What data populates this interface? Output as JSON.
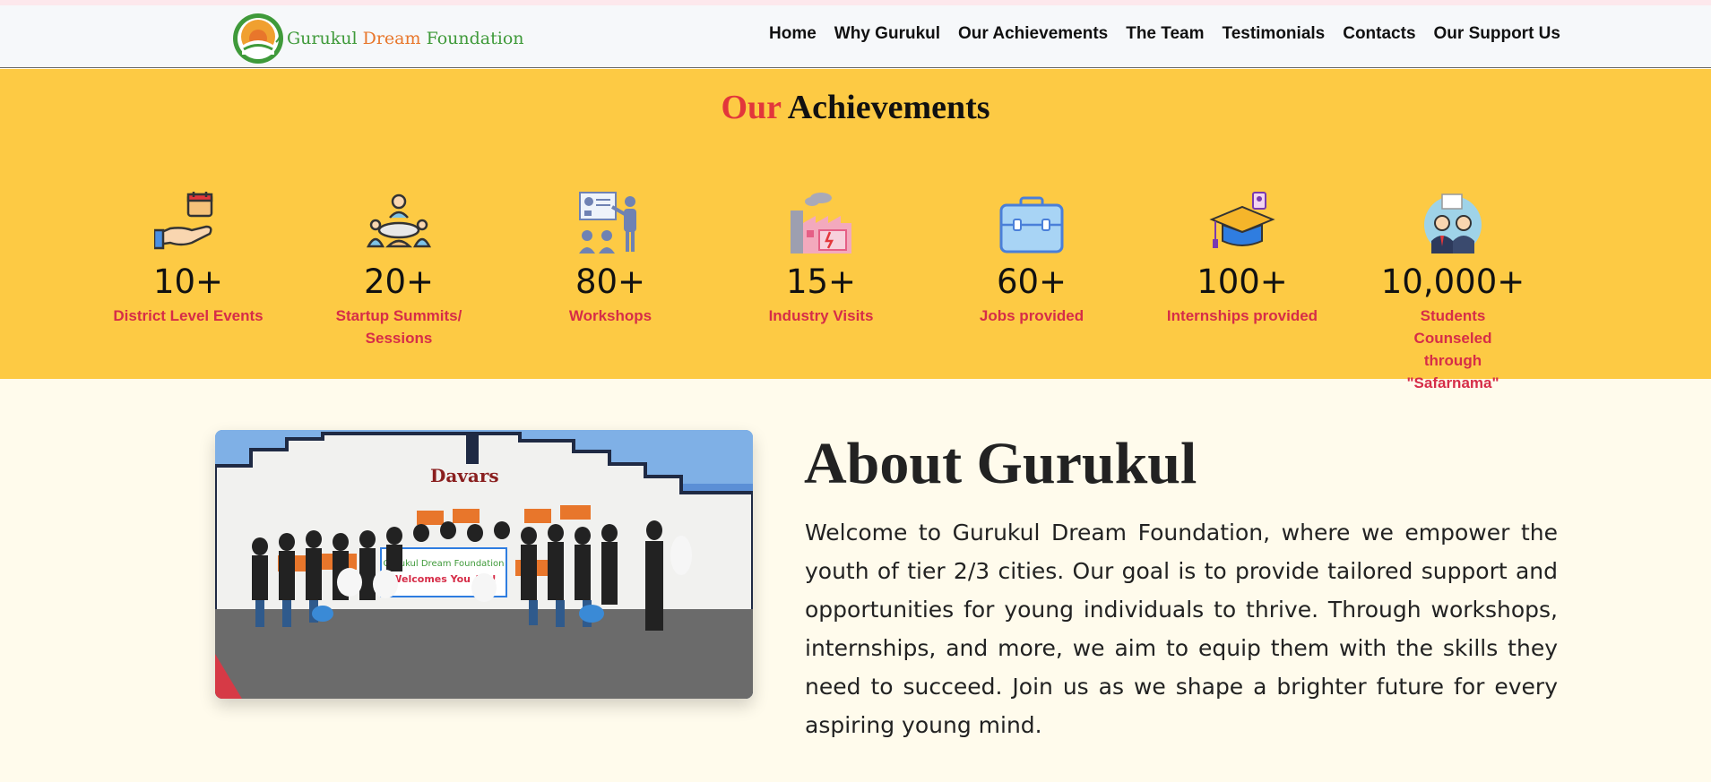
{
  "brand": {
    "part1": "Gurukul",
    "part2": "Dream",
    "part3": "Foundation",
    "logo_icon": "sun-logo-icon"
  },
  "nav": {
    "items": [
      "Home",
      "Why Gurukul",
      "Our Achievements",
      "The Team",
      "Testimonials",
      "Contacts",
      "Our Support Us"
    ]
  },
  "achievements": {
    "title_our": "Our",
    "title_rest": "Achievements",
    "stats": [
      {
        "icon": "event-calendar-hand-icon",
        "value": "10+",
        "label": "District Level Events"
      },
      {
        "icon": "summit-meeting-icon",
        "value": "20+",
        "label": "Startup Summits/ Sessions"
      },
      {
        "icon": "workshop-presentation-icon",
        "value": "80+",
        "label": "Workshops"
      },
      {
        "icon": "factory-icon",
        "value": "15+",
        "label": "Industry Visits"
      },
      {
        "icon": "briefcase-icon",
        "value": "60+",
        "label": "Jobs provided"
      },
      {
        "icon": "graduation-cap-icon",
        "value": "100+",
        "label": "Internships provided"
      },
      {
        "icon": "counseling-people-icon",
        "value": "10,000+",
        "label": "Students Counseled through \"Safarnama\""
      }
    ]
  },
  "photo": {
    "sign_text": "Davars",
    "banner_title": "Gurukul Dream Foundation",
    "banner_text": "Welcomes You All !"
  },
  "about": {
    "title": "About Gurukul",
    "text": "Welcome to Gurukul Dream Foundation, where we empower the youth of tier 2/3 cities. Our goal is to provide tailored support and opportunities for young individuals to thrive. Through workshops, internships, and more, we aim to equip them with the skills they need to succeed. Join us as we shape a brighter future for every aspiring young mind."
  },
  "colors": {
    "accent_red": "#d62d48",
    "banner_yellow": "#fdca44",
    "nav_bg": "#f6f8fa",
    "page_bg": "#fffbec"
  }
}
